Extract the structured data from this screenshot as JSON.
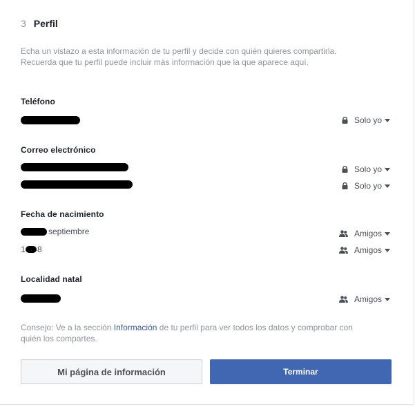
{
  "step": {
    "number": "3",
    "title": "Perfil"
  },
  "intro": "Echa un vistazo a esta información de tu perfil y decide con quién quieres compartirla. Recuerda que tu perfil puede incluir más información que la que aparece aquí.",
  "sections": {
    "phone": {
      "title": "Teléfono",
      "privacy": "Solo yo"
    },
    "email": {
      "title": "Correo electrónico",
      "privacy_1": "Solo yo",
      "privacy_2": "Solo yo"
    },
    "birthday": {
      "title": "Fecha de nacimiento",
      "month": "septiembre",
      "year_prefix": "1",
      "year_suffix": "8",
      "privacy_1": "Amigos",
      "privacy_2": "Amigos"
    },
    "hometown": {
      "title": "Localidad natal",
      "privacy": "Amigos"
    }
  },
  "tip": {
    "before": "Consejo: Ve a la sección ",
    "link": "Información",
    "after": " de tu perfil para ver todos los datos y comprobar con quién los compartes."
  },
  "buttons": {
    "about": "Mi página de información",
    "finish": "Terminar"
  },
  "colors": {
    "primary": "#4267b2",
    "link": "#365899",
    "muted": "#90949c",
    "text": "#1d2129"
  },
  "icons": {
    "only_me": "lock-icon",
    "friends": "friends-icon",
    "dropdown": "caret-down-icon"
  }
}
